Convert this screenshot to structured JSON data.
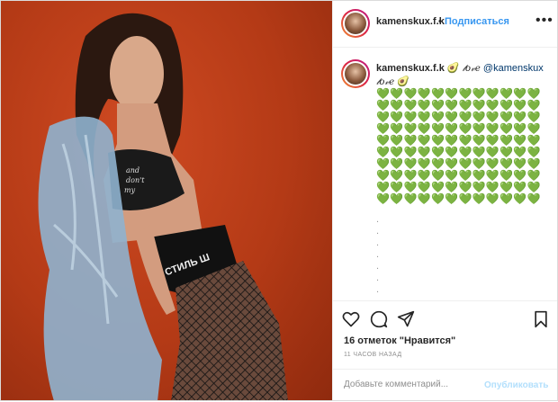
{
  "post": {
    "username": "kamenskux.f.k",
    "separator": "•",
    "follow_label": "Подписаться",
    "more_label": "•••"
  },
  "caption": {
    "username": "kamenskux.f.k",
    "emoji_avocado": "🥑",
    "script_love": "𝓁𝑜𝓋𝑒",
    "mention": "@kamenskux",
    "line2_script": "𝓁𝑜𝓋𝑒",
    "hearts_rows": [
      "💚💚💚💚💚💚💚💚💚💚💚💚",
      "💚💚💚💚💚💚💚💚💚💚💚💚",
      "💚💚💚💚💚💚💚💚💚💚💚💚",
      "💚💚💚💚💚💚💚💚💚💚💚💚",
      "💚💚💚💚💚💚💚💚💚💚💚💚",
      "💚💚💚💚💚💚💚💚💚💚💚💚",
      "💚💚💚💚💚💚💚💚💚💚💚💚",
      "💚💚💚💚💚💚💚💚💚💚💚💚",
      "💚💚💚💚💚💚💚💚💚💚💚💚",
      "💚💚💚💚💚💚💚💚💚💚💚💚"
    ],
    "dots": [
      ".",
      ".",
      ".",
      ".",
      ".",
      ".",
      "."
    ]
  },
  "photo": {
    "shirt_text_1": "and",
    "shirt_text_2": "don't",
    "shirt_text_3": "my",
    "waistband_text": "Р СТИЛЬ Ш"
  },
  "actions": {
    "like_icon": "heart-outline-icon",
    "comment_icon": "comment-bubble-icon",
    "share_icon": "paper-plane-icon",
    "save_icon": "bookmark-icon"
  },
  "likes_text": "16 отметок \"Нравится\"",
  "time_text": "11 ЧАСОВ НАЗАД",
  "comment": {
    "placeholder": "Добавьте комментарий...",
    "post_label": "Опубликовать"
  },
  "colors": {
    "accent": "#3897f0",
    "background_photo": "#b43a16",
    "hearts": "#2fa52f"
  }
}
